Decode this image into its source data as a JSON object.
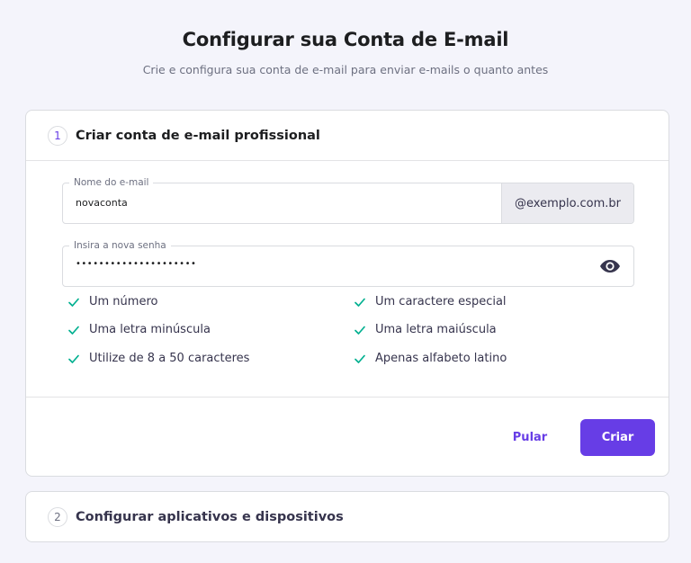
{
  "header": {
    "title": "Configurar sua Conta de E-mail",
    "subtitle": "Crie e configura sua conta de e-mail para enviar e-mails o quanto antes"
  },
  "step1": {
    "number": "1",
    "title": "Criar conta de e-mail profissional",
    "email_field": {
      "label": "Nome do e-mail",
      "value": "novaconta",
      "domain": "@exemplo.com.br"
    },
    "password_field": {
      "label": "Insira a nova senha",
      "value": "•••••••••••••••••••••",
      "toggle_icon": "eye-icon"
    },
    "requirements": [
      {
        "label": "Um número",
        "met": true
      },
      {
        "label": "Um caractere especial",
        "met": true
      },
      {
        "label": "Uma letra minúscula",
        "met": true
      },
      {
        "label": "Uma letra maiúscula",
        "met": true
      },
      {
        "label": "Utilize de 8 a 50 caracteres",
        "met": true
      },
      {
        "label": "Apenas alfabeto latino",
        "met": true
      }
    ],
    "skip_label": "Pular",
    "create_label": "Criar"
  },
  "step2": {
    "number": "2",
    "title": "Configurar aplicativos e dispositivos"
  },
  "colors": {
    "accent": "#673de6",
    "check": "#00b090",
    "background": "#f4f4fb"
  }
}
